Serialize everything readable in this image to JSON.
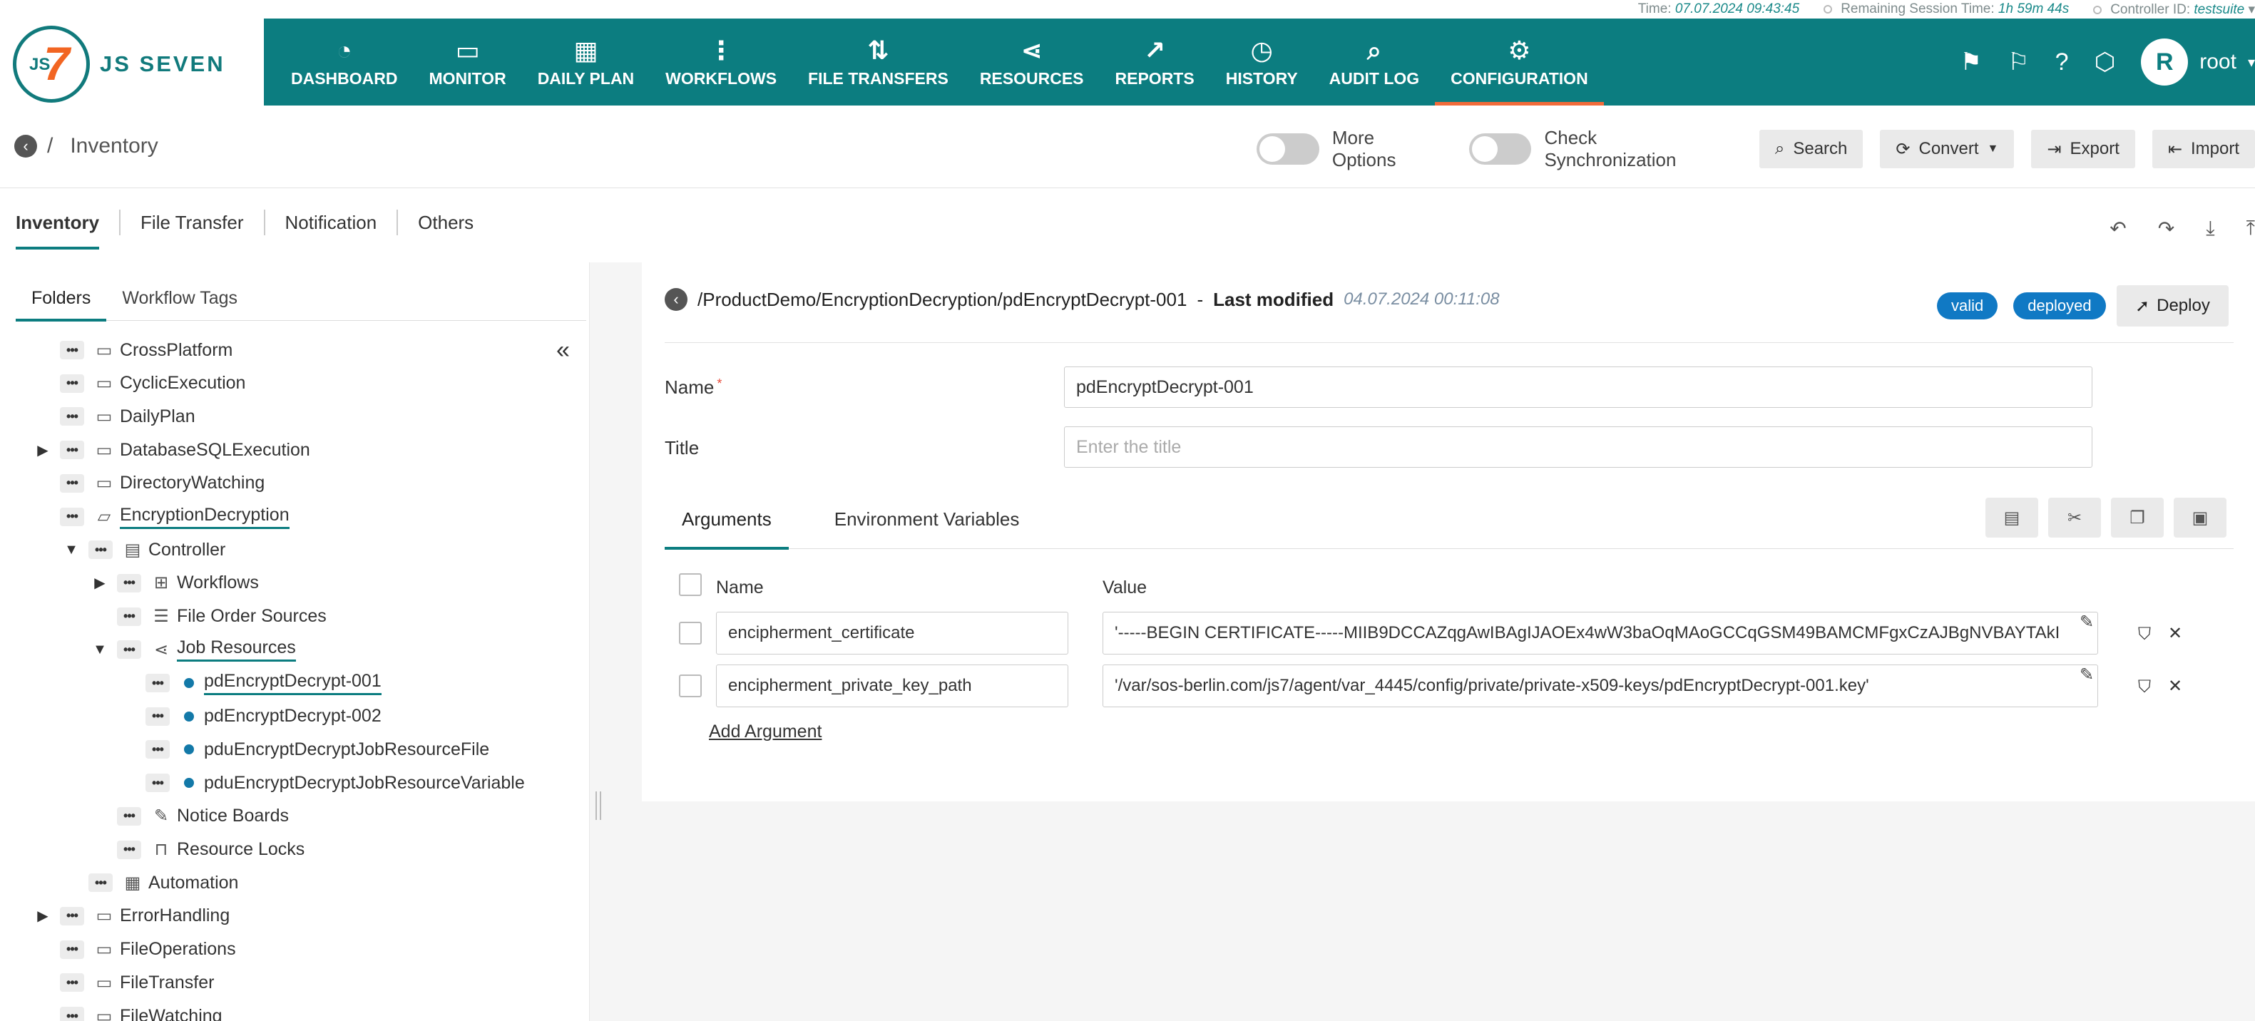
{
  "status": {
    "time_label": "Time:",
    "time_value": "07.07.2024 09:43:45",
    "remaining_label": "Remaining Session Time:",
    "remaining_value": "1h 59m 44s",
    "controller_label": "Controller ID:",
    "controller_value": "testsuite"
  },
  "logo": {
    "text": "JS SEVEN",
    "mark_js": "JS",
    "mark_seven": "7"
  },
  "nav": [
    {
      "label": "DASHBOARD",
      "icon": "dashboard-icon",
      "glyph": "◔"
    },
    {
      "label": "MONITOR",
      "icon": "monitor-icon",
      "glyph": "▭"
    },
    {
      "label": "DAILY PLAN",
      "icon": "daily-plan-icon",
      "glyph": "▦"
    },
    {
      "label": "WORKFLOWS",
      "icon": "workflows-icon",
      "glyph": "⋮"
    },
    {
      "label": "FILE TRANSFERS",
      "icon": "file-transfers-icon",
      "glyph": "⇅"
    },
    {
      "label": "RESOURCES",
      "icon": "resources-icon",
      "glyph": "⋖"
    },
    {
      "label": "REPORTS",
      "icon": "reports-icon",
      "glyph": "↗"
    },
    {
      "label": "HISTORY",
      "icon": "history-icon",
      "glyph": "◷"
    },
    {
      "label": "AUDIT LOG",
      "icon": "audit-log-icon",
      "glyph": "⌕"
    },
    {
      "label": "CONFIGURATION",
      "icon": "configuration-icon",
      "glyph": "⚙",
      "active": true
    }
  ],
  "header_right": {
    "avatar_letter": "R",
    "username": "root"
  },
  "breadcrumb": {
    "separator": "/",
    "title": "Inventory"
  },
  "toolbar": {
    "more_options": "More Options",
    "check_sync": "Check Synchronization",
    "search": "Search",
    "convert": "Convert",
    "export": "Export",
    "import": "Import"
  },
  "main_tabs": [
    "Inventory",
    "File Transfer",
    "Notification",
    "Others"
  ],
  "subtabs": [
    "Folders",
    "Workflow Tags"
  ],
  "tree": [
    {
      "label": "CrossPlatform",
      "indent": 0,
      "caret": "",
      "icon": "folder-icon",
      "glyph": "▭"
    },
    {
      "label": "CyclicExecution",
      "indent": 0,
      "caret": "",
      "icon": "folder-icon",
      "glyph": "▭"
    },
    {
      "label": "DailyPlan",
      "indent": 0,
      "caret": "",
      "icon": "folder-icon",
      "glyph": "▭"
    },
    {
      "label": "DatabaseSQLExecution",
      "indent": 0,
      "caret": "▶",
      "icon": "folder-icon",
      "glyph": "▭"
    },
    {
      "label": "DirectoryWatching",
      "indent": 0,
      "caret": "",
      "icon": "folder-icon",
      "glyph": "▭"
    },
    {
      "label": "EncryptionDecryption",
      "indent": 0,
      "caret": "",
      "icon": "folder-open-icon",
      "glyph": "▱",
      "selected": true
    },
    {
      "label": "Controller",
      "indent": 1,
      "caret": "▼",
      "icon": "controller-icon",
      "glyph": "▤"
    },
    {
      "label": "Workflows",
      "indent": 2,
      "caret": "▶",
      "icon": "workflows-tree-icon",
      "glyph": "⊞"
    },
    {
      "label": "File Order Sources",
      "indent": 2,
      "caret": "",
      "icon": "file-order-sources-icon",
      "glyph": "☰"
    },
    {
      "label": "Job Resources",
      "indent": 2,
      "caret": "▼",
      "icon": "job-resources-icon",
      "glyph": "⋖",
      "selected": true
    },
    {
      "label": "pdEncryptDecrypt-001",
      "indent": 3,
      "caret": "",
      "icon": "dot",
      "glyph": "",
      "selected": true
    },
    {
      "label": "pdEncryptDecrypt-002",
      "indent": 3,
      "caret": "",
      "icon": "dot",
      "glyph": ""
    },
    {
      "label": "pduEncryptDecryptJobResourceFile",
      "indent": 3,
      "caret": "",
      "icon": "dot",
      "glyph": ""
    },
    {
      "label": "pduEncryptDecryptJobResourceVariable",
      "indent": 3,
      "caret": "",
      "icon": "dot",
      "glyph": ""
    },
    {
      "label": "Notice Boards",
      "indent": 2,
      "caret": "",
      "icon": "notice-boards-icon",
      "glyph": "✎"
    },
    {
      "label": "Resource Locks",
      "indent": 2,
      "caret": "",
      "icon": "resource-locks-icon",
      "glyph": "⊓"
    },
    {
      "label": "Automation",
      "indent": 1,
      "caret": "",
      "icon": "automation-icon",
      "glyph": "▦"
    },
    {
      "label": "ErrorHandling",
      "indent": 0,
      "caret": "▶",
      "icon": "folder-icon",
      "glyph": "▭"
    },
    {
      "label": "FileOperations",
      "indent": 0,
      "caret": "",
      "icon": "folder-icon",
      "glyph": "▭"
    },
    {
      "label": "FileTransfer",
      "indent": 0,
      "caret": "",
      "icon": "folder-icon",
      "glyph": "▭"
    },
    {
      "label": "FileWatching",
      "indent": 0,
      "caret": "",
      "icon": "folder-icon",
      "glyph": "▭"
    }
  ],
  "detail": {
    "path": "/ProductDemo/EncryptionDecryption/pdEncryptDecrypt-001",
    "dash": "-",
    "last_modified_label": "Last modified",
    "last_modified_value": "04.07.2024 00:11:08",
    "badge_valid": "valid",
    "badge_deployed": "deployed",
    "deploy": "Deploy",
    "name_label": "Name",
    "name_required": "*",
    "name_value": "pdEncryptDecrypt-001",
    "title_label": "Title",
    "title_placeholder": "Enter the title",
    "tab_arguments": "Arguments",
    "tab_env": "Environment Variables",
    "col_name": "Name",
    "col_value": "Value",
    "arguments": [
      {
        "name": "encipherment_certificate",
        "value": "'-----BEGIN CERTIFICATE-----MIIB9DCCAZqgAwIBAgIJAOEx4wW3baOqMAoGCCqGSM49BAMCMFgxCzAJBgNVBAYTAkI"
      },
      {
        "name": "encipherment_private_key_path",
        "value": "'/var/sos-berlin.com/js7/agent/var_4445/config/private/private-x509-keys/pdEncryptDecrypt-001.key'"
      }
    ],
    "add_argument": "Add Argument"
  },
  "colors": {
    "header": "#0c7d80",
    "accent": "#f26b3a",
    "badge": "#1079c4"
  }
}
